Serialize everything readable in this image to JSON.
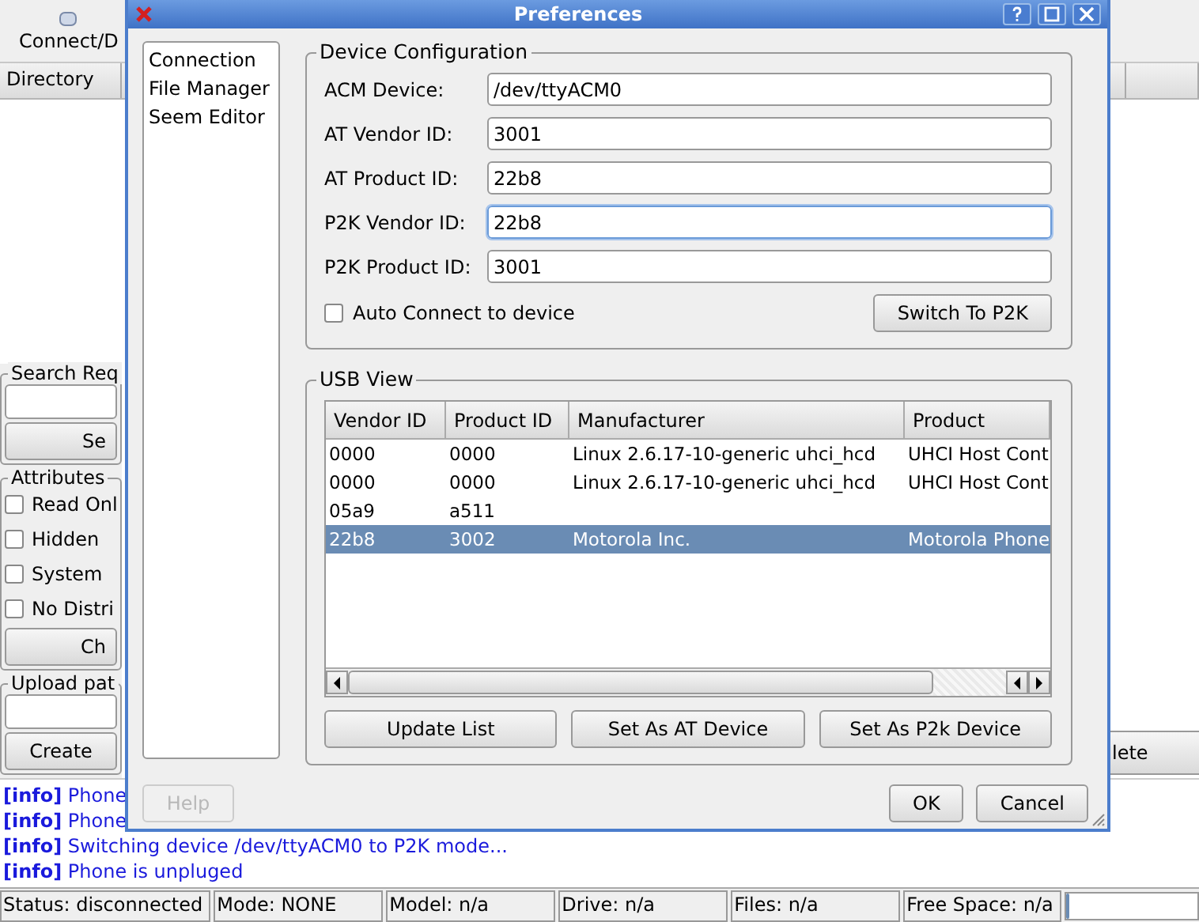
{
  "main_window": {
    "toolbar": {
      "button": "Connect/D"
    },
    "file_list": {
      "columns": [
        "Directory"
      ]
    },
    "search_group": {
      "title": "Search Req",
      "button": "Se"
    },
    "attributes": {
      "title": "Attributes",
      "items": [
        {
          "label": "Read Onl",
          "checked": false
        },
        {
          "label": "Hidden",
          "checked": false
        },
        {
          "label": "System",
          "checked": false
        },
        {
          "label": "No Distri",
          "checked": false
        }
      ],
      "button": "Ch"
    },
    "upload_group": {
      "title": "Upload pat",
      "button": "Create"
    },
    "side_button": "lete",
    "log": [
      "**[info]** Phone",
      "**[info]** Phone",
      "**[info]** Switching device /dev/ttyACM0 to P2K mode...",
      "**[info]** Phone is unpluged"
    ],
    "status_bar": {
      "fields": [
        "Status: disconnected",
        "Mode: NONE",
        "Model: n/a",
        "Drive: n/a",
        "Files: n/a",
        "Free Space: n/a"
      ],
      "progress": {
        "level": 0.03
      }
    }
  },
  "dialog": {
    "title": "Preferences",
    "nav": [
      "Connection",
      "File Manager",
      "Seem Editor"
    ],
    "device_config": {
      "title": "Device Configuration",
      "fields": [
        {
          "label": "ACM Device:",
          "value": "/dev/ttyACM0",
          "focused": false
        },
        {
          "label": "AT Vendor ID:",
          "value": "3001",
          "focused": false
        },
        {
          "label": "AT Product ID:",
          "value": "22b8",
          "focused": false
        },
        {
          "label": "P2K Vendor ID:",
          "value": "22b8",
          "focused": true
        },
        {
          "label": "P2K Product ID:",
          "value": "3001",
          "focused": false
        }
      ],
      "auto_connect": {
        "label": "Auto Connect to device",
        "checked": false
      },
      "switch_button": "Switch To P2K"
    },
    "usb_view": {
      "title": "USB View",
      "columns": [
        "Vendor ID",
        "Product ID",
        "Manufacturer",
        "Product"
      ],
      "rows": [
        {
          "cells": [
            "0000",
            "0000",
            "Linux 2.6.17-10-generic uhci_hcd",
            "UHCI Host Cont"
          ],
          "selected": false
        },
        {
          "cells": [
            "0000",
            "0000",
            "Linux 2.6.17-10-generic uhci_hcd",
            "UHCI Host Cont"
          ],
          "selected": false
        },
        {
          "cells": [
            "05a9",
            "a511",
            "",
            ""
          ],
          "selected": false
        },
        {
          "cells": [
            "22b8",
            "3002",
            "Motorola Inc.",
            "Motorola Phone"
          ],
          "selected": true
        }
      ],
      "buttons": [
        "Update List",
        "Set As AT Device",
        "Set As P2k Device"
      ]
    },
    "help_button": {
      "label": "Help",
      "disabled": true
    },
    "buttons": [
      "OK",
      "Cancel"
    ]
  }
}
